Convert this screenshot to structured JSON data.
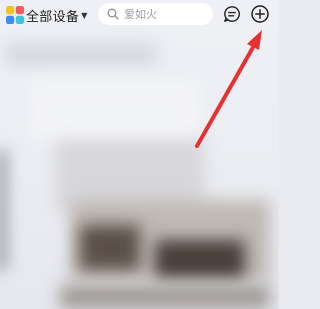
{
  "header": {
    "device_selector_label": "全部设备",
    "search_placeholder": "爱如火"
  },
  "icons": {
    "logo": "app-logo-icon",
    "caret": "caret-down-icon",
    "search": "search-icon",
    "message": "message-icon",
    "add": "add-circle-icon",
    "annotation": "red-arrow-annotation"
  },
  "colors": {
    "annotation_red": "#e8302f",
    "logo_yellow": "#f7c21b",
    "logo_red": "#f25b5b",
    "logo_blue": "#3c8bf6",
    "logo_cyan": "#36c7d8"
  }
}
